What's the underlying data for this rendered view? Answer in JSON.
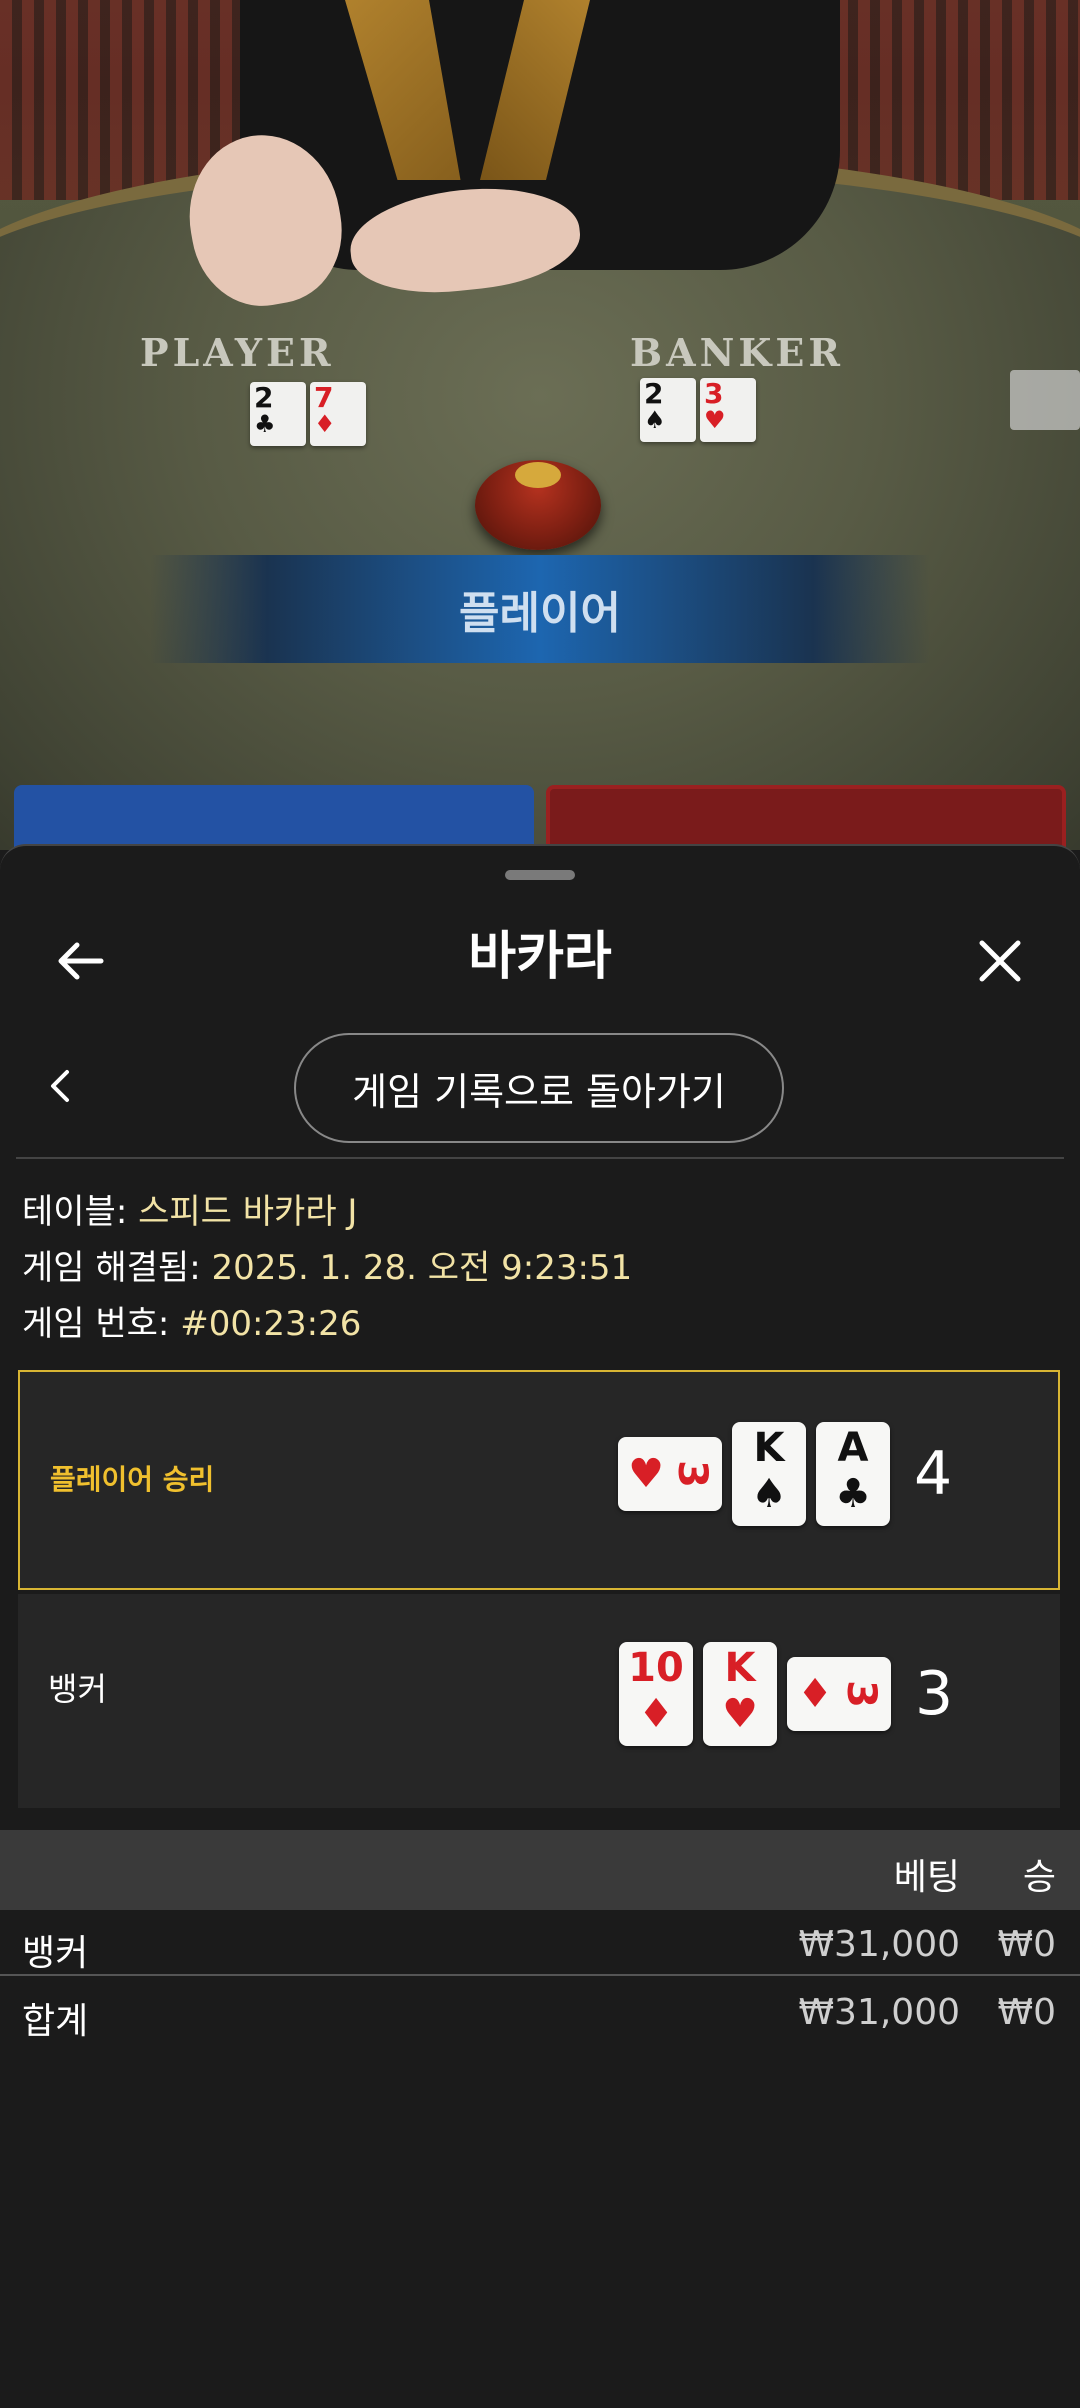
{
  "video": {
    "player_side_label": "PLAYER",
    "banker_side_label": "BANKER",
    "player_cards": [
      {
        "rank": "2",
        "suit": "♣",
        "color": "black"
      },
      {
        "rank": "7",
        "suit": "♦",
        "color": "red"
      }
    ],
    "banker_cards": [
      {
        "rank": "2",
        "suit": "♠",
        "color": "black"
      },
      {
        "rank": "3",
        "suit": "♥",
        "color": "red"
      }
    ],
    "result_banner": "플레이어"
  },
  "header": {
    "title": "바카라",
    "back_icon": "arrow-left-icon",
    "close_icon": "close-icon"
  },
  "nav": {
    "prev_icon": "chevron-left-icon",
    "return_label": "게임 기록으로 돌아가기"
  },
  "meta": {
    "table_label": "테이블:",
    "table_value": "스피드 바카라 J",
    "resolved_label": "게임 해결됨:",
    "resolved_value": "2025. 1. 28. 오전 9:23:51",
    "game_no_label": "게임 번호:",
    "game_no_value": "#00:23:26"
  },
  "outcomes": {
    "player": {
      "label": "플레이어 승리",
      "total": "4",
      "cards": [
        {
          "rank": "3",
          "suit": "♥",
          "color": "red",
          "orientation": "horizontal"
        },
        {
          "rank": "K",
          "suit": "♠",
          "color": "black",
          "orientation": "vertical"
        },
        {
          "rank": "A",
          "suit": "♣",
          "color": "black",
          "orientation": "vertical"
        }
      ]
    },
    "banker": {
      "label": "뱅커",
      "total": "3",
      "cards": [
        {
          "rank": "10",
          "suit": "♦",
          "color": "red",
          "orientation": "vertical"
        },
        {
          "rank": "K",
          "suit": "♥",
          "color": "red",
          "orientation": "vertical"
        },
        {
          "rank": "3",
          "suit": "♦",
          "color": "red",
          "orientation": "horizontal"
        }
      ]
    }
  },
  "bets_table": {
    "headers": {
      "bet": "베팅",
      "win": "승"
    },
    "rows": [
      {
        "name": "뱅커",
        "bet": "₩31,000",
        "win": "₩0"
      },
      {
        "name": "합계",
        "bet": "₩31,000",
        "win": "₩0"
      }
    ]
  },
  "colors": {
    "win_border": "#d8b533",
    "win_label": "#f0c02e",
    "meta_value": "#f2e3a6",
    "player_zone": "#2352a4",
    "banker_zone": "#7a1b1b"
  }
}
